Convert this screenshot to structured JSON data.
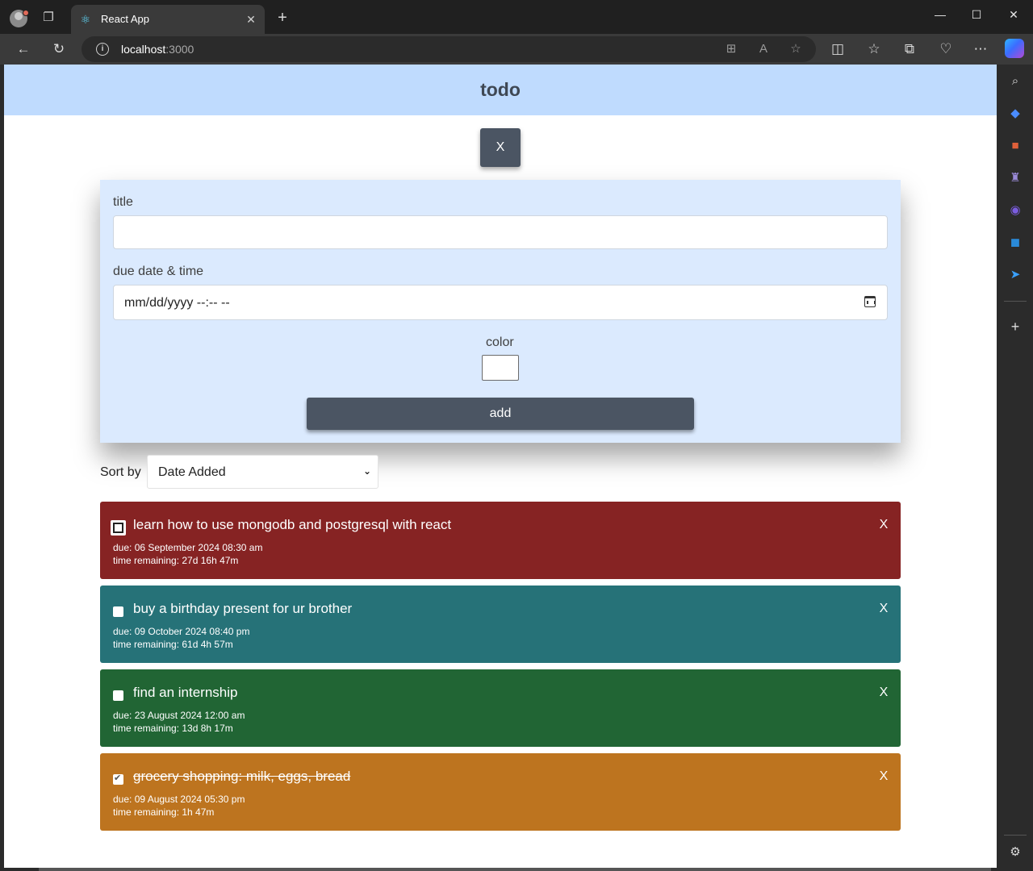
{
  "browser": {
    "tab_title": "React App",
    "tab_close": "✕",
    "new_tab": "+",
    "url_host": "localhost",
    "url_port": ":3000",
    "icons": [
      "profile-icon",
      "tab-actions-icon",
      "react-favicon-icon",
      "back-icon",
      "refresh-icon",
      "site-info-icon",
      "app-available-icon",
      "read-aloud-icon",
      "favorite-icon",
      "split-screen-icon",
      "favorites-icon",
      "collections-icon",
      "browser-essentials-icon",
      "more-icon",
      "copilot-icon"
    ],
    "window_controls": {
      "minimize": "—",
      "maximize": "☐",
      "close": "✕"
    }
  },
  "sidebar": {
    "icons": [
      "search-icon",
      "shopping-icon",
      "tools-icon",
      "games-icon",
      "microsoft365-icon",
      "outlook-icon",
      "send-icon",
      "add-icon",
      "settings-icon"
    ]
  },
  "app": {
    "title": "todo",
    "toggle_label": "X",
    "form": {
      "title_label": "title",
      "title_value": "",
      "due_label": "due date & time",
      "due_placeholder": "mm/dd/yyyy --:-- --",
      "color_label": "color",
      "color_value": "#ffffff",
      "add_label": "add"
    },
    "sort": {
      "label": "Sort by",
      "selected": "Date Added"
    },
    "todos": [
      {
        "title": "learn how to use mongodb and postgresql with react",
        "due": "due: 06 September 2024 08:30 am",
        "remaining": "time remaining: 27d 16h 47m",
        "color": "#862323",
        "completed": false,
        "delete_label": "X"
      },
      {
        "title": "buy a birthday present for ur brother",
        "due": "due: 09 October 2024 08:40 pm",
        "remaining": "time remaining: 61d 4h 57m",
        "color": "#267278",
        "completed": false,
        "delete_label": "X"
      },
      {
        "title": "find an internship",
        "due": "due: 23 August 2024 12:00 am",
        "remaining": "time remaining: 13d 8h 17m",
        "color": "#216534",
        "completed": false,
        "delete_label": "X"
      },
      {
        "title": "grocery shopping: milk, eggs, bread",
        "due": "due: 09 August 2024 05:30 pm",
        "remaining": "time remaining: 1h 47m",
        "color": "#bd741f",
        "completed": true,
        "delete_label": "X"
      }
    ]
  }
}
